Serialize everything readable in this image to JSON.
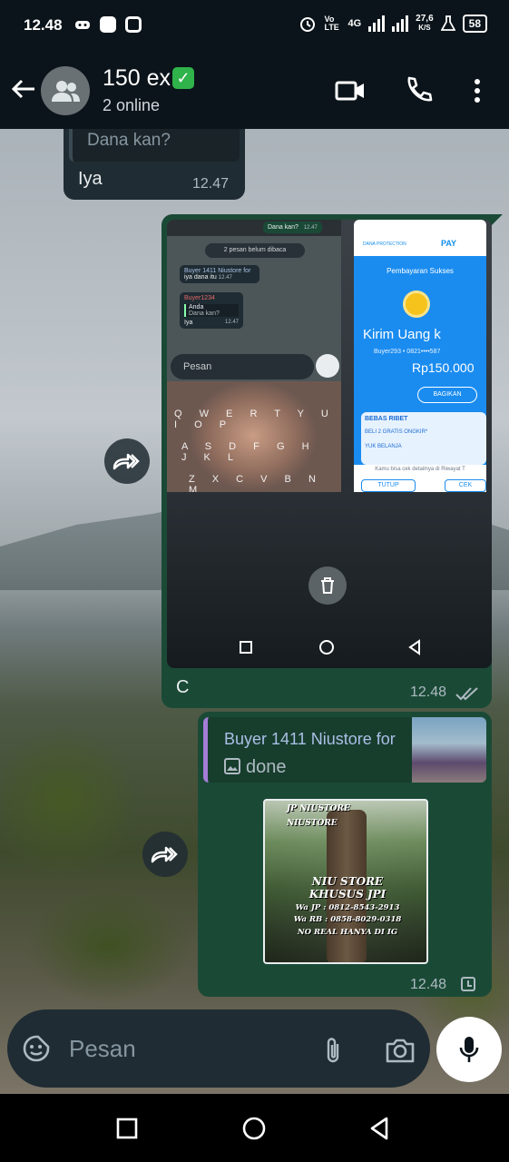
{
  "status_bar": {
    "time": "12.48",
    "network_label": "Vo LTE",
    "network_gen": "4G",
    "speed_value": "27,6",
    "speed_unit": "K/S",
    "battery": "58"
  },
  "header": {
    "title": "150 ex",
    "title_emoji": "✅",
    "subtitle": "2 online",
    "icons": [
      "back-arrow-icon",
      "group-avatar-icon",
      "video-call-icon",
      "voice-call-icon",
      "more-options-icon"
    ]
  },
  "messages": [
    {
      "direction": "in",
      "quoted_text": "Dana kan?",
      "text": "Iya",
      "time": "12.47"
    },
    {
      "direction": "out",
      "media": {
        "chat_screenshot": {
          "top_bubble": "Dana kan?",
          "top_bubble_time": "12.47",
          "unread_banner": "2 pesan belum dibaca",
          "buyer_msg": "Buyer 1411 Niustore for",
          "buyer_msg_body": "iya dana itu",
          "buyer_msg_time": "12.47",
          "sender": "Buyer1234",
          "reply_name": "Anda",
          "reply_text": "Dana kan?",
          "reply_body": "Iya",
          "reply_time": "12.47",
          "input_placeholder": "Pesan",
          "keyboard_rows": [
            "Q W E R T Y U I O P",
            "A S D F G H J K L",
            "Z X C V B N M"
          ]
        },
        "dana_screenshot": {
          "brand": "DANA PROTECTION",
          "pay": "PAY",
          "status": "Pembayaran Sukses",
          "title": "Kirim Uang k",
          "buyer": "Buyer293 • 0821••••587",
          "amount": "Rp150.000",
          "share_button": "BAGIKAN",
          "promo_title": "BEBAS RIBET",
          "promo_buy": "BELI 2 GRATIS ONGKIR*",
          "promo_cta": "YUK BELANJA",
          "footer": "Kamu bisa cek detailnya di Riwayat T",
          "close_button": "TUTUP",
          "check_button": "CEK"
        }
      },
      "text": "C",
      "time": "12.48",
      "status": "read"
    },
    {
      "direction": "out",
      "reply_to_name": "Buyer 1411 Niustore for",
      "reply_to_text": "done",
      "poster": {
        "line1": "JP NIUSTORE",
        "line2": "NIUSTORE",
        "line3": "NIU STORE",
        "line4": "KHUSUS JPI",
        "line5": "Wa JP : 0812-8543-2913",
        "line6": "Wa RB : 0858-8029-0318",
        "line7": "NO REAL HANYA DI IG"
      },
      "time": "12.48",
      "status": "pending"
    }
  ],
  "composer": {
    "placeholder": "Pesan"
  },
  "colors": {
    "header_bg": "#0b141a",
    "incoming_bubble": "#202c33",
    "outgoing_bubble": "#1a4a36",
    "reply_accent": "#a57dd6"
  }
}
